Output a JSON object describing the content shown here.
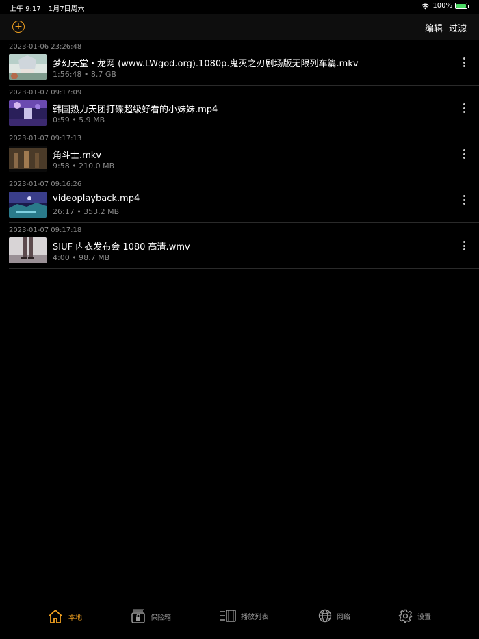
{
  "status": {
    "time": "上午 9:17",
    "date": "1月7日周六",
    "battery": "100%"
  },
  "nav": {
    "add_icon": "plus-circle-icon",
    "edit": "编辑",
    "filter": "过滤"
  },
  "items": [
    {
      "date": "2023-01-06 23:26:48",
      "title": "梦幻天堂・龙网 (www.LWgod.org).1080p.鬼灭之刃剧场版无限列车篇.mkv",
      "meta": "1:56:48 • 8.7 GB"
    },
    {
      "date": "2023-01-07 09:17:09",
      "title": "韩国热力天团打碟超级好看的小妹妹.mp4",
      "meta": "0:59 • 5.9 MB"
    },
    {
      "date": "2023-01-07 09:17:13",
      "title": "角斗士.mkv",
      "meta": "9:58 • 210.0 MB"
    },
    {
      "date": "2023-01-07 09:16:26",
      "title": "videoplayback.mp4",
      "meta": "26:17 • 353.2 MB"
    },
    {
      "date": "2023-01-07 09:17:18",
      "title": "SIUF 内衣发布会 1080 高清.wmv",
      "meta": "4:00 • 98.7 MB"
    }
  ],
  "tabs": {
    "local": "本地",
    "vault": "保险箱",
    "playlist": "播放列表",
    "network": "网络",
    "settings": "设置"
  },
  "colors": {
    "accent": "#f0a020",
    "background": "#000000"
  }
}
